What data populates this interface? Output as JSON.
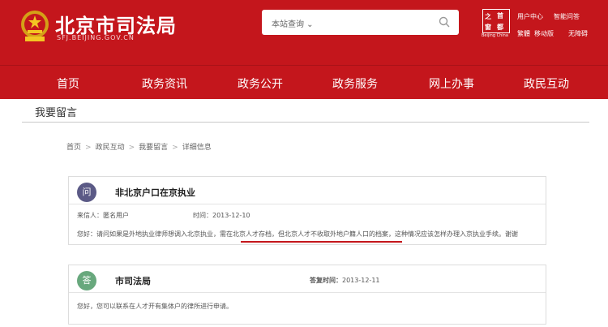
{
  "header": {
    "site_name": "北京市司法局",
    "site_domain": "SFJ.BEIJING.GOV.CN",
    "search_scope": "本站查询 ⌄",
    "logo_chars": [
      "之",
      "首",
      "窗",
      "都"
    ],
    "logo_sub": "Beijing China",
    "utility_links": [
      "用户中心",
      "智能问答",
      "繁體",
      "移动版",
      "无障碍"
    ]
  },
  "nav": {
    "items": [
      "首页",
      "政务资讯",
      "政务公开",
      "政务服务",
      "网上办事",
      "政民互动"
    ]
  },
  "section_title": "我要留言",
  "breadcrumb": [
    "首页",
    "政民互动",
    "我要留言",
    "详细信息"
  ],
  "breadcrumb_sep": ">",
  "question": {
    "badge": "问",
    "title": "非北京户口在京执业",
    "sender_label": "来信人：",
    "sender": "匿名用户",
    "time_label": "时间：",
    "time": "2013-12-10",
    "body": "您好：请问如果是外地执业律师想调入北京执业，需在北京人才存档，但北京人才不收取外地户籍人口的档案，这种情况应该怎样办理入京执业手续。谢谢"
  },
  "answer": {
    "badge": "答",
    "title": "市司法局",
    "time_label": "答复时间：",
    "time": "2013-12-11",
    "body": "您好，您可以联系在人才开有集体户的律所进行申请。"
  },
  "colors": {
    "brand_red": "#c4161c",
    "question_badge": "#5b5a86",
    "answer_badge": "#68a87d"
  }
}
